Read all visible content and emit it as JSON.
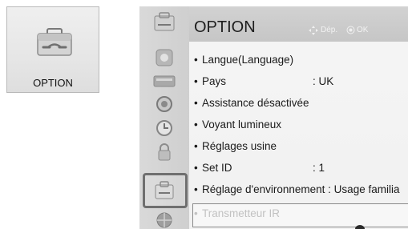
{
  "tile": {
    "label": "OPTION",
    "icon": "toolbox-icon"
  },
  "screen": {
    "title": "OPTION",
    "hints": {
      "move_icon": "dpad-icon",
      "move_label": "Dép.",
      "ok_icon": "ok-button-icon",
      "ok_label": "OK"
    },
    "rail_icons": [
      "picture-icon",
      "audio-icon",
      "channel-icon",
      "time-icon",
      "lock-icon",
      "option-icon",
      "network-icon"
    ],
    "selected_rail_icon": "option-icon",
    "items": [
      {
        "label": "Langue(Language)"
      },
      {
        "label": "Pays",
        "value": ": UK"
      },
      {
        "label": "Assistance désactivée"
      },
      {
        "label": "Voyant lumineux"
      },
      {
        "label": "Réglages usine"
      },
      {
        "label": "Set ID",
        "value": ": 1"
      },
      {
        "label": "Réglage d'environnement : Usage familia"
      },
      {
        "label": "Transmetteur IR",
        "disabled": true
      }
    ],
    "bullet": "•"
  }
}
